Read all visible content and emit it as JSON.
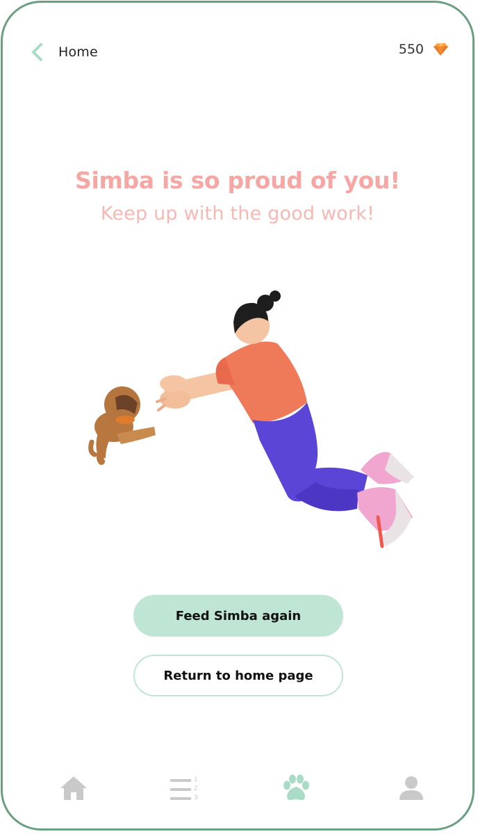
{
  "header": {
    "back_label": "Home",
    "coin_count": "550",
    "back_icon": "chevron-left-icon",
    "currency_icon": "gem-icon"
  },
  "message": {
    "title": "Simba is so proud of you!",
    "subtitle": "Keep up with the good work!"
  },
  "actions": {
    "primary_label": "Feed Simba again",
    "secondary_label": "Return to home page"
  },
  "nav": {
    "items": [
      {
        "icon": "home-icon",
        "active": false
      },
      {
        "icon": "numbered-list-icon",
        "active": false
      },
      {
        "icon": "paw-icon",
        "active": true
      },
      {
        "icon": "profile-icon",
        "active": false
      }
    ],
    "list_icon_digits": [
      "1",
      "2",
      "3"
    ]
  },
  "colors": {
    "frame": "#6a9f82",
    "accent": "#bfe6d4",
    "headline": "#f7a7a3",
    "active_nav": "#a8dcc6",
    "inactive_nav": "#c9c9c9",
    "back_chevron": "#a8dcc6"
  }
}
